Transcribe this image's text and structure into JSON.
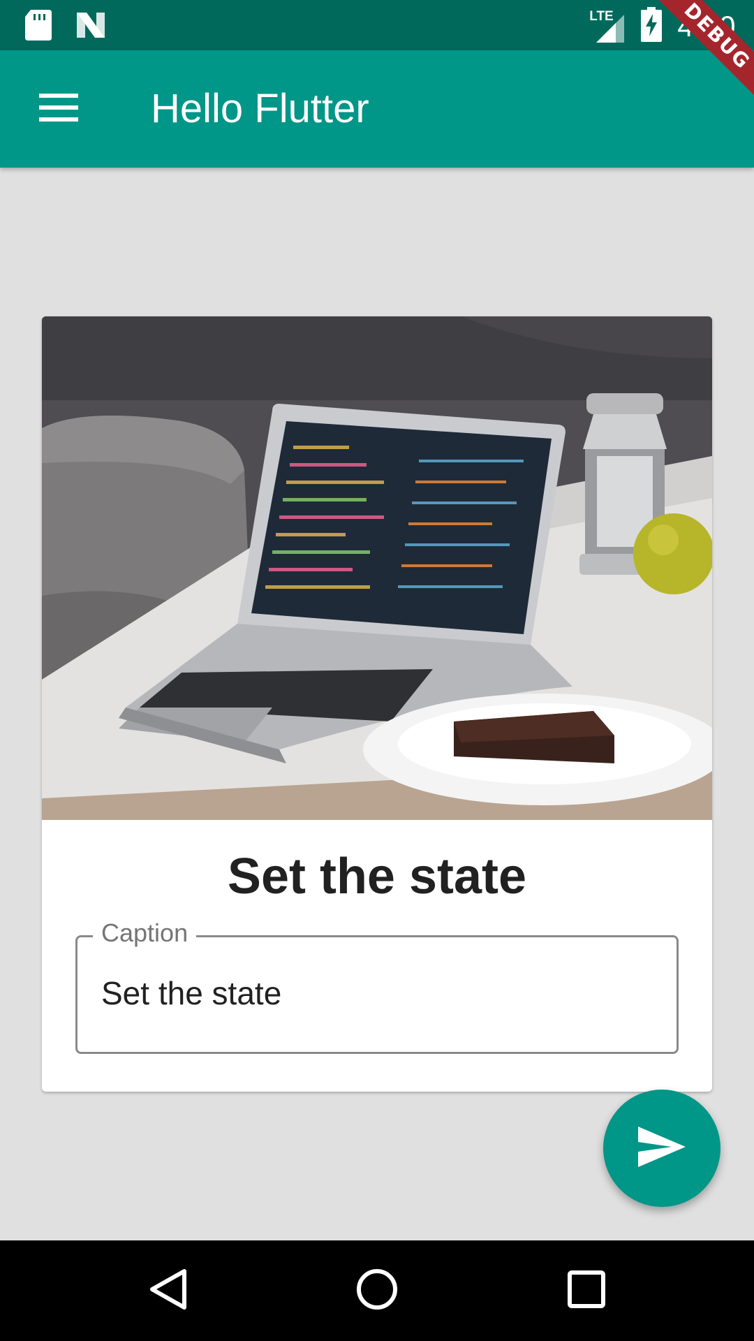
{
  "status_bar": {
    "time": "4:00",
    "network_label": "LTE",
    "icons": [
      "sd-card-icon",
      "n-logo-icon",
      "signal-icon",
      "battery-charging-icon"
    ]
  },
  "app_bar": {
    "title": "Hello Flutter",
    "menu_icon": "menu-icon",
    "debug_banner": "DEBUG",
    "colors": {
      "status_bar": "#00695c",
      "app_bar": "#009688",
      "debug_banner": "#a4262c"
    }
  },
  "card": {
    "image_description_icon": "photo",
    "title": "Set the state",
    "caption_field": {
      "label": "Caption",
      "value": "Set the state"
    }
  },
  "fab": {
    "icon": "send-icon",
    "color": "#009688"
  },
  "nav_bar": {
    "buttons": [
      "back-icon",
      "home-icon",
      "recents-icon"
    ]
  }
}
